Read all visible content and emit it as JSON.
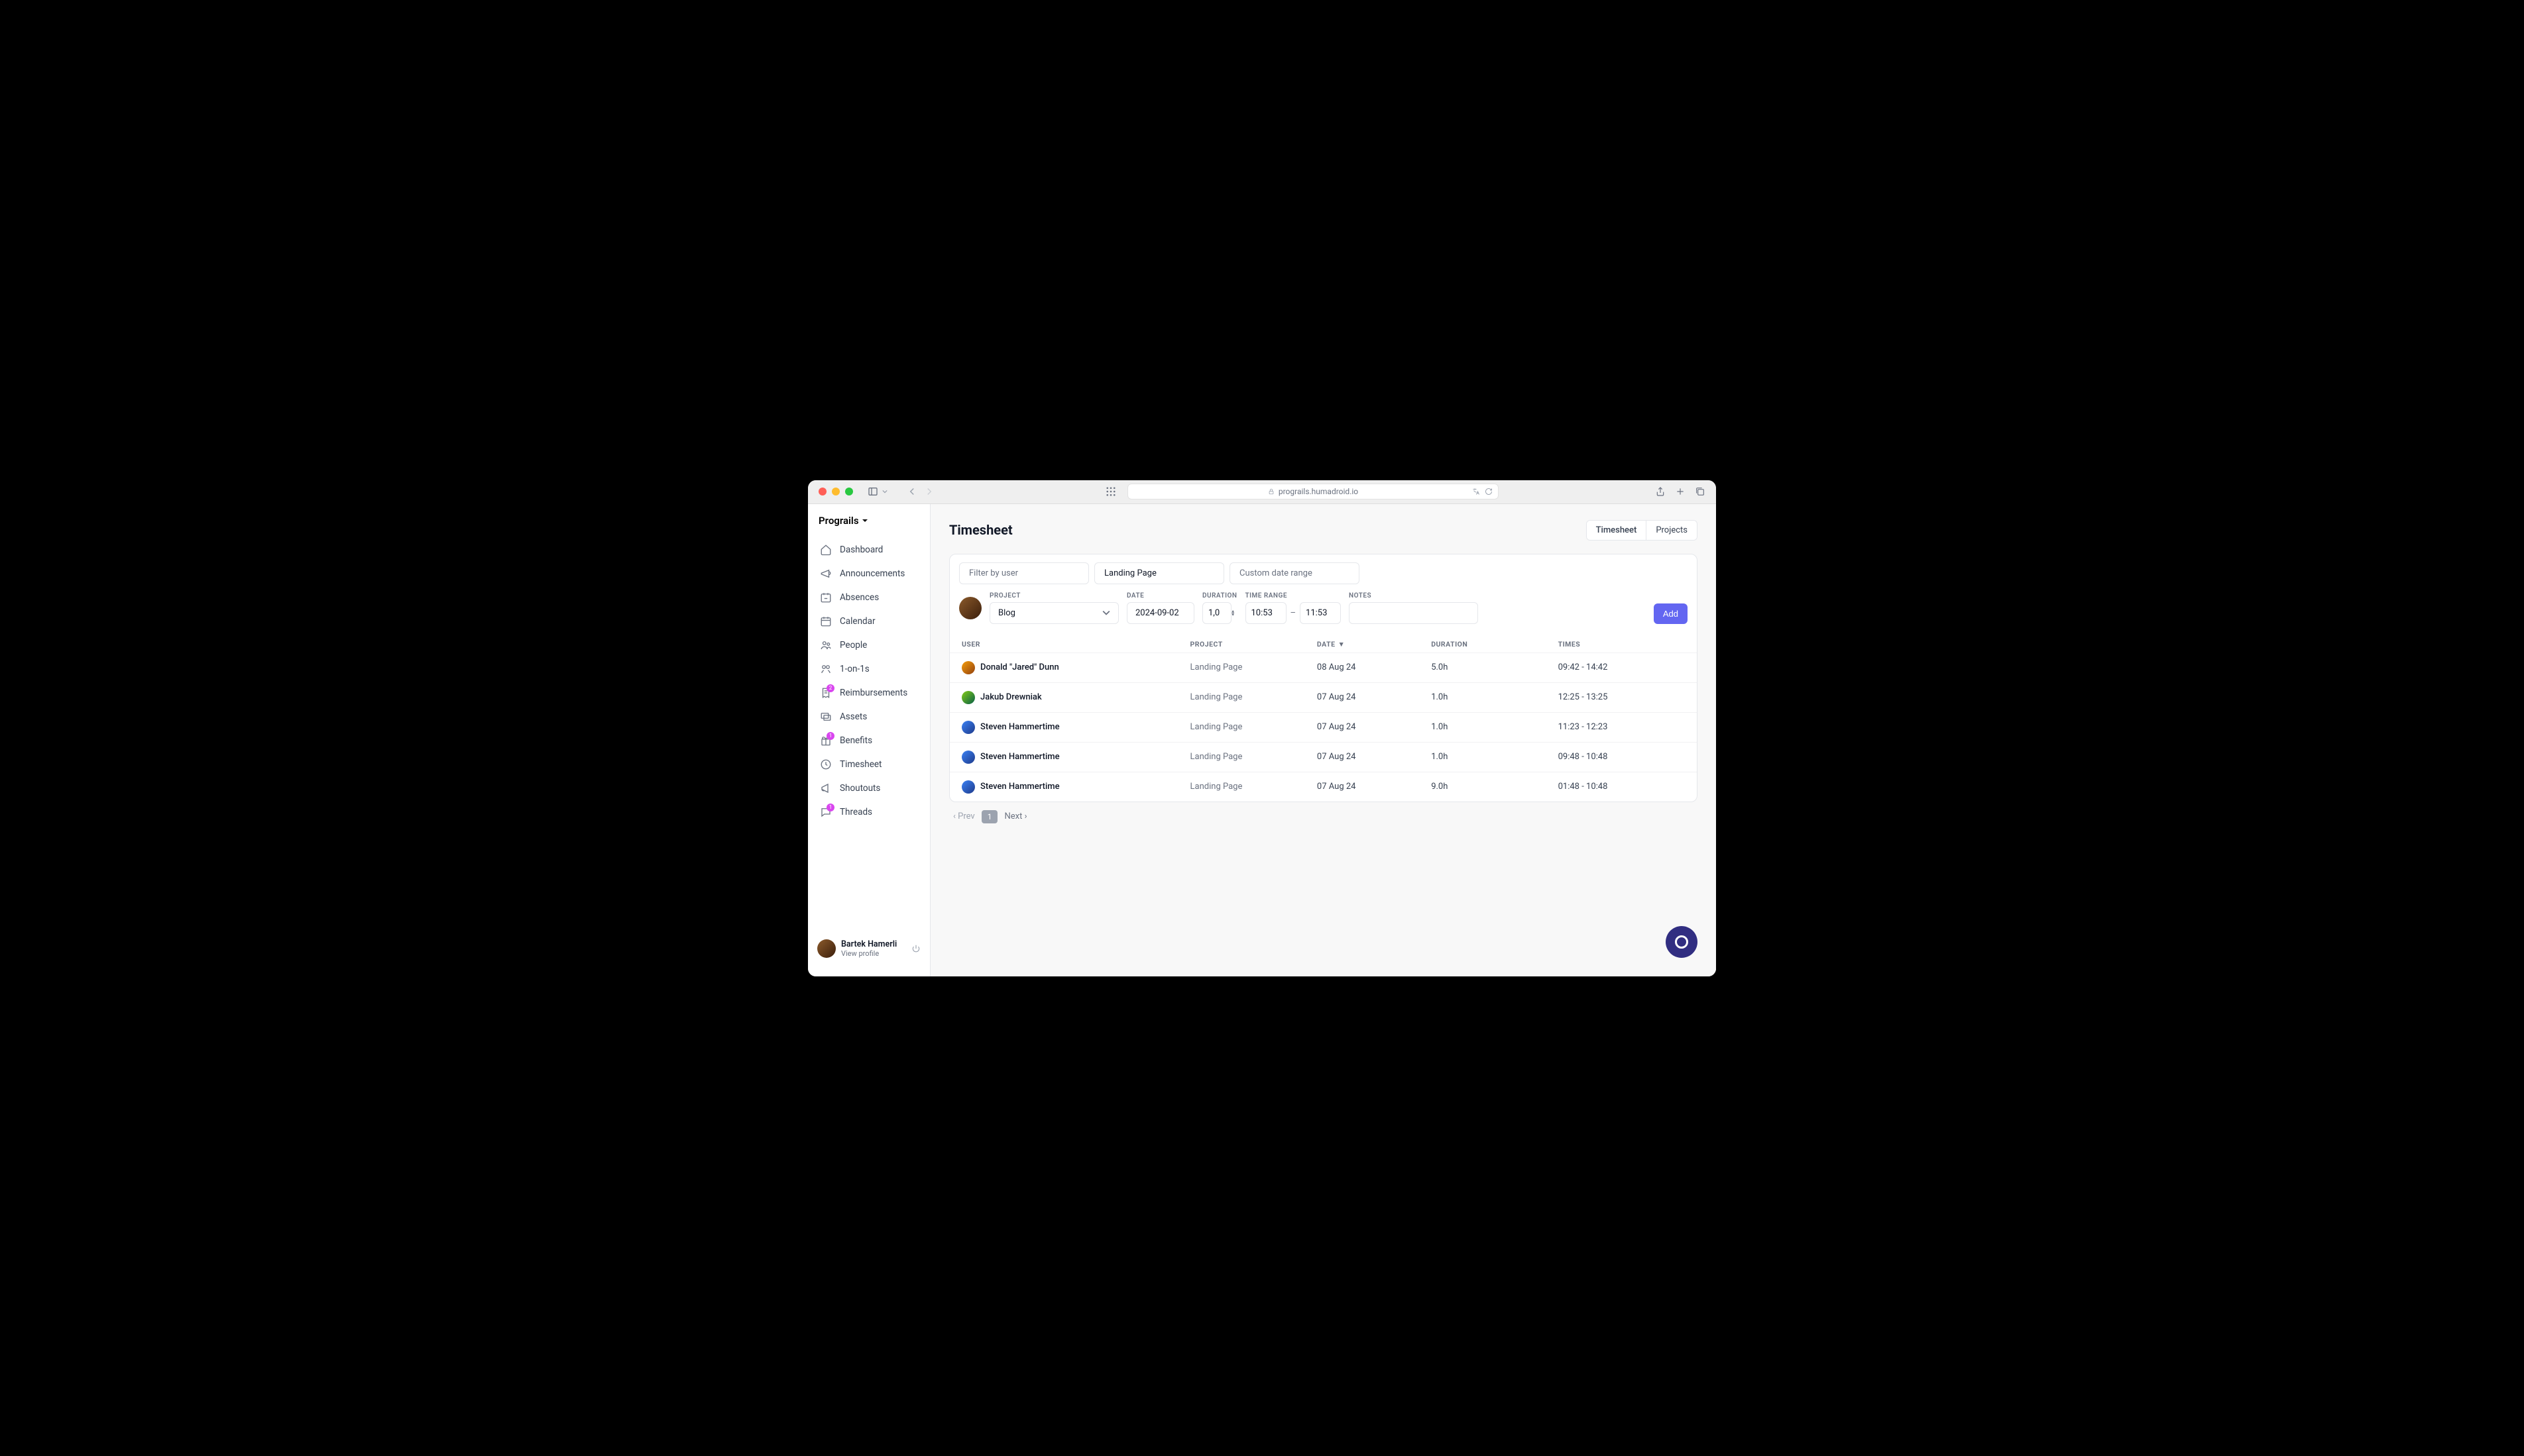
{
  "browser": {
    "url": "prograils.humadroid.io"
  },
  "org": {
    "name": "Prograils"
  },
  "sidebar": {
    "items": [
      {
        "label": "Dashboard",
        "icon": "home"
      },
      {
        "label": "Announcements",
        "icon": "announce"
      },
      {
        "label": "Absences",
        "icon": "calendar-minus"
      },
      {
        "label": "Calendar",
        "icon": "calendar"
      },
      {
        "label": "People",
        "icon": "people"
      },
      {
        "label": "1-on-1s",
        "icon": "one-on-one"
      },
      {
        "label": "Reimbursements",
        "icon": "receipt",
        "badge": "2"
      },
      {
        "label": "Assets",
        "icon": "assets"
      },
      {
        "label": "Benefits",
        "icon": "gift",
        "badge": "1"
      },
      {
        "label": "Timesheet",
        "icon": "clock"
      },
      {
        "label": "Shoutouts",
        "icon": "megaphone"
      },
      {
        "label": "Threads",
        "icon": "chat",
        "badge": "1"
      }
    ]
  },
  "profile": {
    "name": "Bartek Hamerli",
    "sub": "View profile"
  },
  "page": {
    "title": "Timesheet",
    "tabs": [
      {
        "label": "Timesheet",
        "active": true
      },
      {
        "label": "Projects",
        "active": false
      }
    ]
  },
  "filters": {
    "user_placeholder": "Filter by user",
    "project_value": "Landing Page",
    "date_range_placeholder": "Custom date range"
  },
  "entry_form": {
    "labels": {
      "project": "PROJECT",
      "date": "DATE",
      "duration": "DURATION",
      "time_range": "TIME RANGE",
      "notes": "NOTES"
    },
    "project": "Blog",
    "date": "2024-09-02",
    "duration": "1,0",
    "time_from": "10:53",
    "time_to": "11:53",
    "notes": "",
    "add_button": "Add"
  },
  "table": {
    "columns": {
      "user": "USER",
      "project": "PROJECT",
      "date": "DATE",
      "duration": "DURATION",
      "times": "TIMES"
    },
    "sort_column": "date",
    "sort_dir": "desc",
    "rows": [
      {
        "user": "Donald \"Jared\" Dunn",
        "avatar": "av1",
        "project": "Landing Page",
        "date": "08 Aug 24",
        "duration": "5.0h",
        "times": "09:42 - 14:42"
      },
      {
        "user": "Jakub Drewniak",
        "avatar": "av2",
        "project": "Landing Page",
        "date": "07 Aug 24",
        "duration": "1.0h",
        "times": "12:25 - 13:25"
      },
      {
        "user": "Steven Hammertime",
        "avatar": "av3",
        "project": "Landing Page",
        "date": "07 Aug 24",
        "duration": "1.0h",
        "times": "11:23 - 12:23"
      },
      {
        "user": "Steven Hammertime",
        "avatar": "av3",
        "project": "Landing Page",
        "date": "07 Aug 24",
        "duration": "1.0h",
        "times": "09:48 - 10:48"
      },
      {
        "user": "Steven Hammertime",
        "avatar": "av3",
        "project": "Landing Page",
        "date": "07 Aug 24",
        "duration": "9.0h",
        "times": "01:48 - 10:48"
      }
    ]
  },
  "pagination": {
    "prev": "‹ Prev",
    "current": "1",
    "next": "Next ›"
  }
}
